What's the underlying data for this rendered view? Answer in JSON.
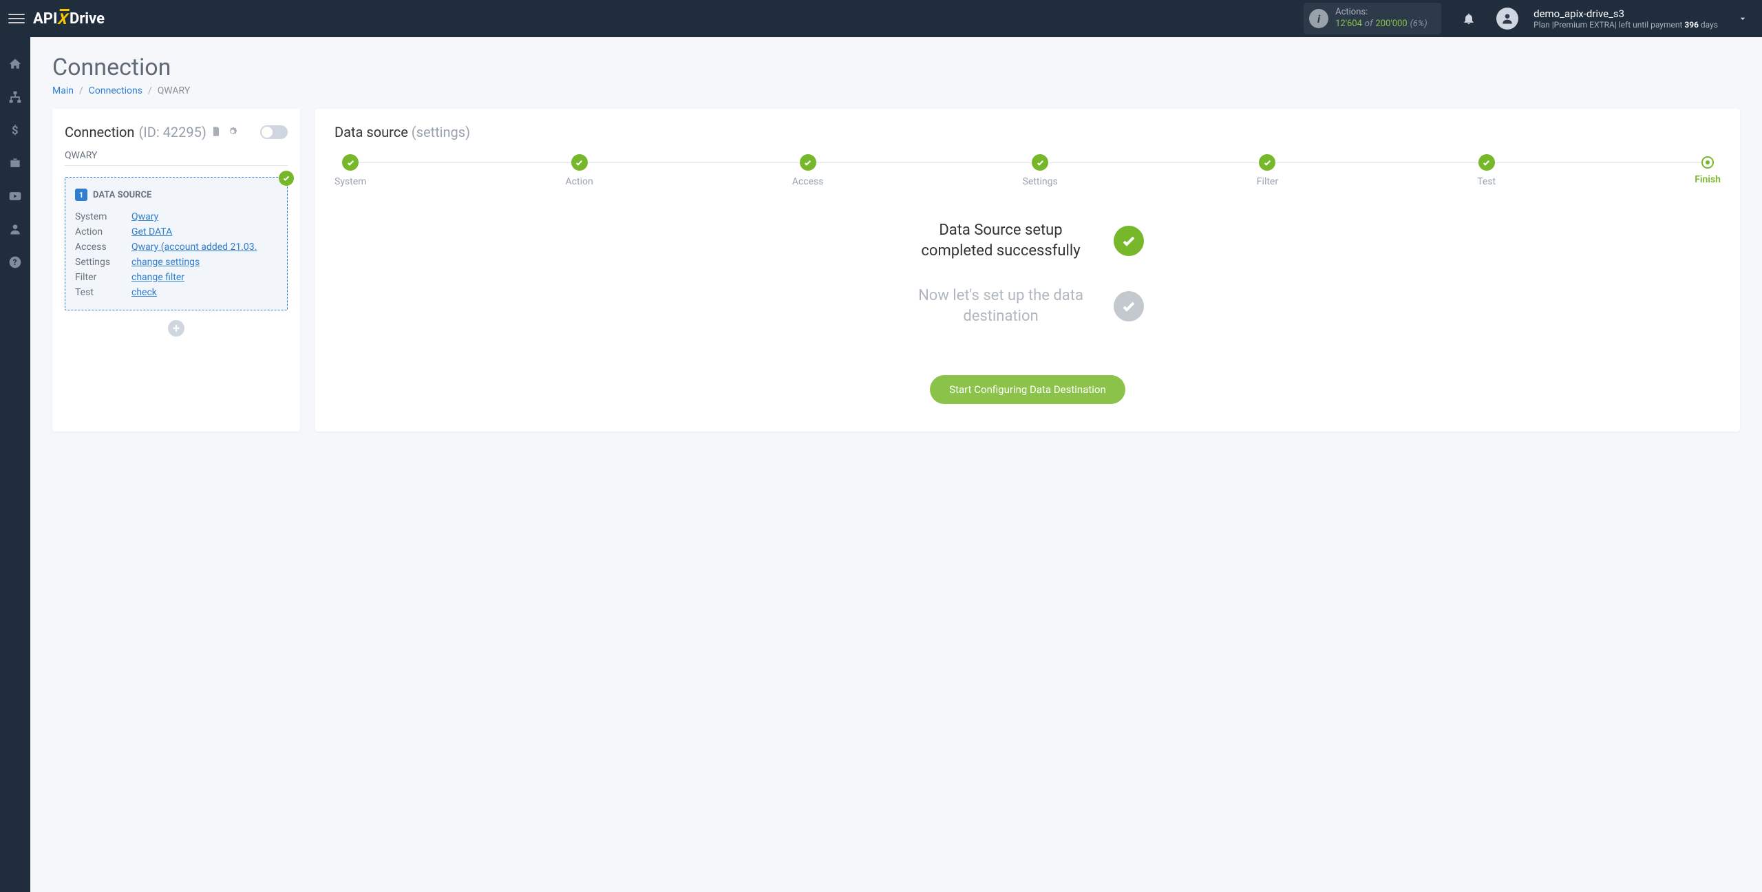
{
  "topbar": {
    "logo": {
      "pre": "API",
      "x": "X",
      "post": "Drive"
    },
    "actions": {
      "label": "Actions:",
      "used": "12'604",
      "of": "of",
      "total": "200'000",
      "pct": "(6%)"
    },
    "account": {
      "name": "demo_apix-drive_s3",
      "plan_prefix": "Plan |",
      "plan_name": "Premium EXTRA",
      "plan_mid": "| left until payment ",
      "days": "396",
      "days_suffix": " days"
    }
  },
  "page": {
    "title": "Connection",
    "breadcrumb": {
      "main": "Main",
      "connections": "Connections",
      "current": "QWARY"
    }
  },
  "conn": {
    "title": "Connection ",
    "id": "(ID: 42295)",
    "name": "QWARY"
  },
  "source": {
    "title": "DATA SOURCE",
    "num": "1",
    "rows": [
      {
        "label": "System",
        "value": "Qwary"
      },
      {
        "label": "Action",
        "value": "Get DATA"
      },
      {
        "label": "Access",
        "value": "Qwary (account added 21.03."
      },
      {
        "label": "Settings",
        "value": "change settings"
      },
      {
        "label": "Filter",
        "value": "change filter"
      },
      {
        "label": "Test",
        "value": "check"
      }
    ]
  },
  "datasource": {
    "title": "Data source ",
    "sub": "(settings)",
    "steps": [
      "System",
      "Action",
      "Access",
      "Settings",
      "Filter",
      "Test",
      "Finish"
    ],
    "msg_done": "Data Source setup completed successfully",
    "msg_pending": "Now let's set up the data destination",
    "cta": "Start Configuring Data Destination"
  }
}
